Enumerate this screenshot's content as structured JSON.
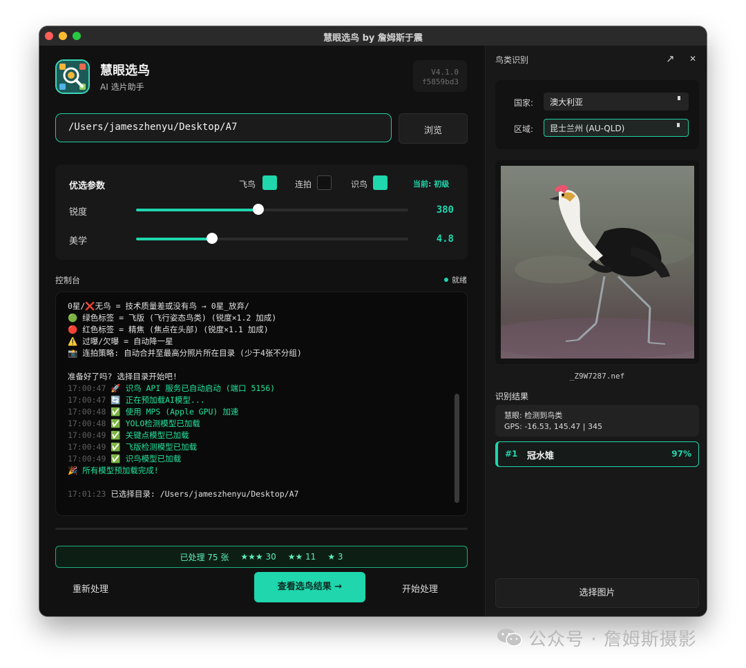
{
  "window": {
    "title": "慧眼选鸟 by 詹姆斯于震"
  },
  "app": {
    "name": "慧眼选鸟",
    "subtitle": "AI 选片助手",
    "version": "V4.1.0",
    "build": "f5859bd3"
  },
  "directory": {
    "path": "/Users/jameszhenyu/Desktop/A7",
    "browse_label": "浏览"
  },
  "params": {
    "title": "优选参数",
    "toggles": [
      {
        "label": "飞鸟",
        "checked": true
      },
      {
        "label": "连拍",
        "checked": false
      },
      {
        "label": "识鸟",
        "checked": true
      }
    ],
    "current_level": "当前: 初级",
    "sharpness": {
      "label": "锐度",
      "value": "380",
      "fraction": 0.45
    },
    "aesthetics": {
      "label": "美学",
      "value": "4.8",
      "fraction": 0.28
    }
  },
  "console": {
    "title": "控制台",
    "status": "就绪",
    "intro_lines": [
      {
        "icon": "",
        "text": "0星/❌无鸟 = 技术质量差或没有鸟 → 0星_放弃/"
      },
      {
        "icon": "🟢",
        "text": " 绿色标签 = 飞版 (飞行姿态鸟类) (锐度×1.2 加成)"
      },
      {
        "icon": "🔴",
        "text": " 红色标签 = 精焦 (焦点在头部) (锐度×1.1 加成)"
      },
      {
        "icon": "⚠️",
        "text": " 过曝/欠曝 = 自动降一星"
      },
      {
        "icon": "📸",
        "text": " 连拍策略: 自动合并至最高分照片所在目录 (少于4张不分组)"
      }
    ],
    "prompt": "准备好了吗? 选择目录开始吧!",
    "log": [
      {
        "time": "17:00:47",
        "icon": "🚀",
        "text": " 识鸟 API 服务已自动启动 (端口 5156)"
      },
      {
        "time": "17:00:47",
        "icon": "🔄",
        "text": " 正在预加载AI模型..."
      },
      {
        "time": "17:00:48",
        "icon": "✅",
        "text": " 使用 MPS (Apple GPU) 加速"
      },
      {
        "time": "17:00:48",
        "icon": "✅",
        "text": " YOLO检测模型已加载"
      },
      {
        "time": "17:00:49",
        "icon": "✅",
        "text": " 关键点模型已加载"
      },
      {
        "time": "17:00:49",
        "icon": "✅",
        "text": " 飞版检测模型已加载"
      },
      {
        "time": "17:00:49",
        "icon": "✅",
        "text": " 识鸟模型已加载"
      }
    ],
    "done": {
      "icon": "🎉",
      "text": " 所有模型预加载完成!"
    },
    "selected": {
      "time": "17:01:23",
      "text": " 已选择目录: /Users/jameszhenyu/Desktop/A7"
    }
  },
  "summary": {
    "processed": "已处理 75 张",
    "three_star": "★★★ 30",
    "two_star": "★★ 11",
    "one_star": "★ 3"
  },
  "actions": {
    "reprocess": "重新处理",
    "view_results": "查看选鸟结果 →",
    "start": "开始处理"
  },
  "identify": {
    "title": "鸟类识别",
    "country_label": "国家:",
    "country_value": "澳大利亚",
    "region_label": "区域:",
    "region_value": "昆士兰州 (AU-QLD)",
    "filename": "_Z9W7287.nef",
    "results_title": "识别结果",
    "detect_line": "慧眼: 检测到鸟类",
    "gps_line": "GPS: -16.53, 145.47 | 345",
    "top_result": {
      "rank": "#1",
      "species": "冠水雉",
      "confidence": "97%"
    },
    "choose_label": "选择图片"
  },
  "watermark": {
    "text": "公众号 · 詹姆斯摄影"
  },
  "colors": {
    "accent": "#1fd6ad",
    "background": "#111111",
    "panel": "#181818",
    "log_green": "#22e39b"
  }
}
